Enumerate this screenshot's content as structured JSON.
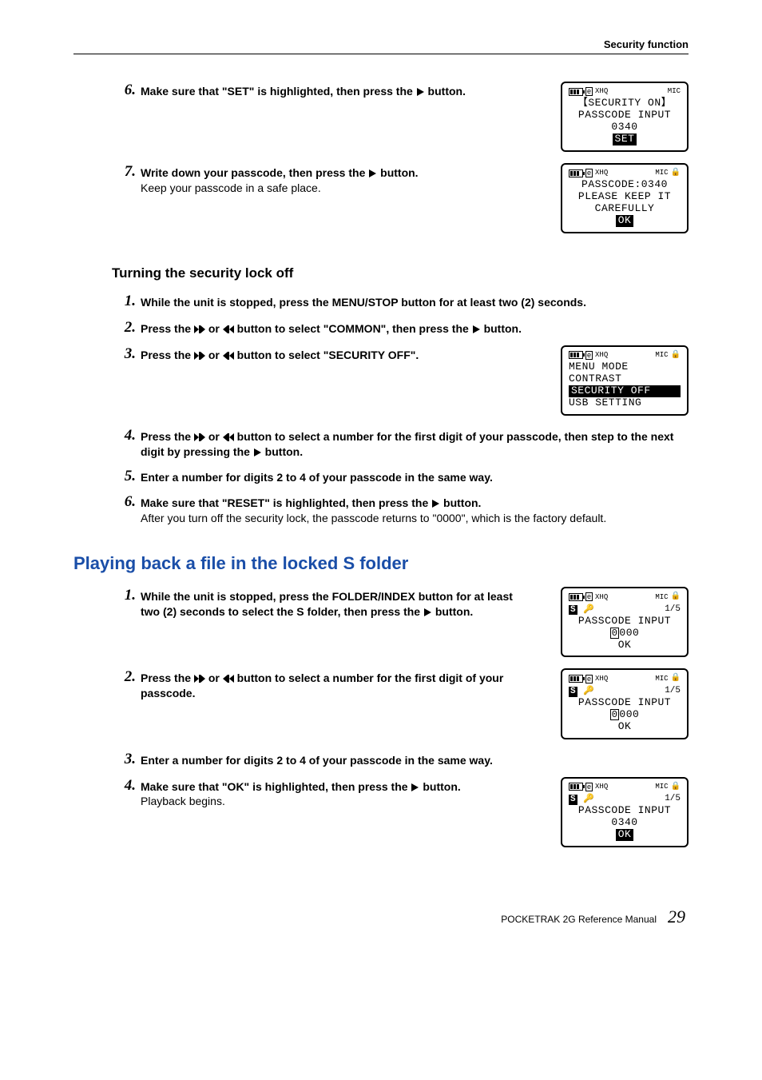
{
  "header": {
    "title": "Security function"
  },
  "section_on": {
    "step6": {
      "num": "6.",
      "bold_a": "Make sure that \"SET\" is highlighted, then press the ",
      "bold_b": " button."
    },
    "screen6": {
      "l1": "【SECURITY ON】",
      "l2": "PASSCODE INPUT",
      "l3": "0340",
      "l4": "SET",
      "xhq": "XHQ",
      "mic": "MIC"
    },
    "step7": {
      "num": "7.",
      "bold_a": "Write down your passcode, then press the ",
      "bold_b": " button.",
      "plain": "Keep your passcode in a safe place."
    },
    "screen7": {
      "l1": "PASSCODE:0340",
      "l2": "PLEASE KEEP IT",
      "l3": "CAREFULLY",
      "l4": "OK",
      "xhq": "XHQ",
      "mic": "MIC"
    }
  },
  "section_off": {
    "heading": "Turning the security lock off",
    "step1": {
      "num": "1.",
      "bold": "While the unit is stopped, press the MENU/STOP button for at least two (2) seconds."
    },
    "step2": {
      "num": "2.",
      "bold_a": "Press the ",
      "bold_b": " or ",
      "bold_c": " button to select \"COMMON\", then press the ",
      "bold_d": " button."
    },
    "step3": {
      "num": "3.",
      "bold_a": "Press the ",
      "bold_b": " or ",
      "bold_c": " button to select \"SECURITY OFF\"."
    },
    "screen3": {
      "l1": "MENU MODE",
      "l2": "CONTRAST",
      "l3": "SECURITY OFF",
      "l4": "USB SETTING",
      "xhq": "XHQ",
      "mic": "MIC"
    },
    "step4": {
      "num": "4.",
      "bold_a": "Press the ",
      "bold_b": " or ",
      "bold_c": " button to select a number for the first digit of your passcode, then step to the next digit by pressing the ",
      "bold_d": " button."
    },
    "step5": {
      "num": "5.",
      "bold": "Enter a number for digits 2 to 4 of your passcode in the same way."
    },
    "step6": {
      "num": "6.",
      "bold_a": "Make sure that \"RESET\" is highlighted, then press the ",
      "bold_b": " button.",
      "plain": "After you turn off the security lock, the passcode returns to \"0000\", which is the factory default."
    }
  },
  "section_play": {
    "heading": "Playing back a file in the locked S folder",
    "step1": {
      "num": "1.",
      "bold_a": "While the unit is stopped, press the FOLDER/INDEX button for at least two (2) seconds to select the S folder, then press the ",
      "bold_b": " button."
    },
    "screen1": {
      "frac": "1/5",
      "l1": "PASSCODE INPUT",
      "l3": "OK",
      "xhq": "XHQ",
      "mic": "MIC",
      "d000": "000"
    },
    "step2": {
      "num": "2.",
      "bold_a": "Press the ",
      "bold_b": " or ",
      "bold_c": " button to select a number for the first digit of your passcode."
    },
    "screen2": {
      "frac": "1/5",
      "l1": "PASSCODE INPUT",
      "l3": "OK",
      "xhq": "XHQ",
      "mic": "MIC",
      "d000": "000"
    },
    "step3": {
      "num": "3.",
      "bold": "Enter a number for digits 2 to 4 of your passcode in the same way."
    },
    "step4": {
      "num": "4.",
      "bold_a": "Make sure that \"OK\" is highlighted, then press the ",
      "bold_b": " button.",
      "plain": "Playback begins."
    },
    "screen4": {
      "frac": "1/5",
      "l1": "PASSCODE INPUT",
      "l2": "0340",
      "l3": "OK",
      "xhq": "XHQ",
      "mic": "MIC"
    }
  },
  "footer": {
    "product": "POCKETRAK 2G   Reference Manual",
    "page": "29"
  }
}
